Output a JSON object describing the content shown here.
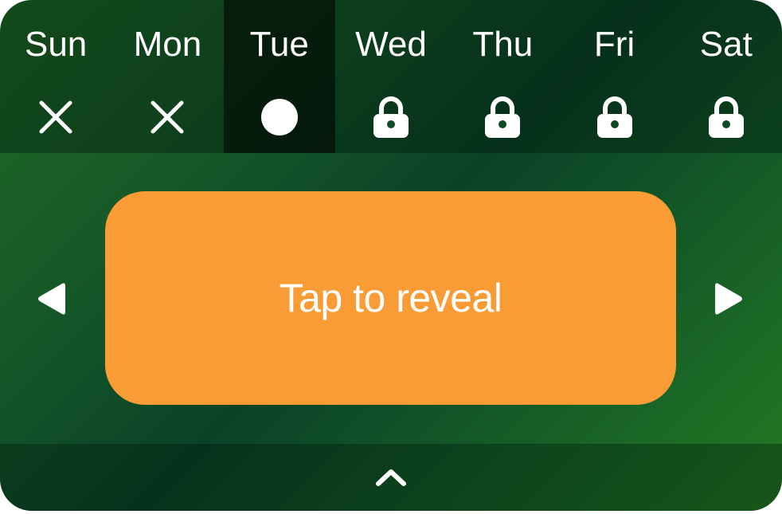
{
  "days": [
    {
      "name": "Sun",
      "status": "missed",
      "icon": "x-icon"
    },
    {
      "name": "Mon",
      "status": "missed",
      "icon": "x-icon"
    },
    {
      "name": "Tue",
      "status": "current",
      "icon": "dot-icon"
    },
    {
      "name": "Wed",
      "status": "locked",
      "icon": "lock-icon"
    },
    {
      "name": "Thu",
      "status": "locked",
      "icon": "lock-icon"
    },
    {
      "name": "Fri",
      "status": "locked",
      "icon": "lock-icon"
    },
    {
      "name": "Sat",
      "status": "locked",
      "icon": "lock-icon"
    }
  ],
  "reveal": {
    "label": "Tap to reveal"
  },
  "navigation": {
    "prev_icon": "triangle-left-icon",
    "next_icon": "triangle-right-icon",
    "expand_icon": "chevron-up-icon"
  },
  "colors": {
    "accent": "#f99c36",
    "background_dark": "#0a4228",
    "background_light": "#237a22",
    "current_day_highlight": "#04170c",
    "text": "#ffffff"
  }
}
